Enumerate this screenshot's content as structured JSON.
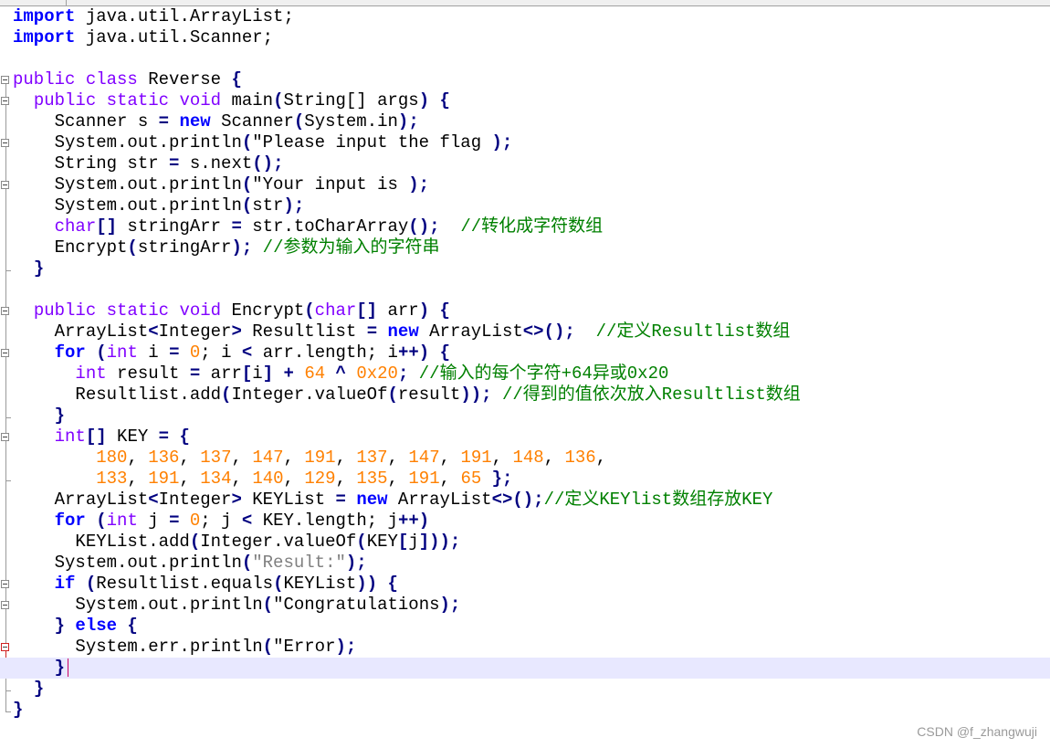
{
  "code": {
    "l1": [
      "import",
      " java.util.ArrayList;"
    ],
    "l2": [
      "import",
      " java.util.Scanner;"
    ],
    "l4": [
      "public class",
      " Reverse ",
      "{"
    ],
    "l5": [
      "  ",
      "public static void",
      " main",
      "(",
      "String",
      "[] args",
      ")",
      " {"
    ],
    "l6": [
      "    Scanner s ",
      "=",
      " ",
      "new",
      " Scanner",
      "(",
      "System.in",
      ");"
    ],
    "l7": [
      "    System.out.println",
      "(",
      "\"Please input the flag ",
      ");"
    ],
    "l8": [
      "    String str ",
      "=",
      " s.next",
      "();"
    ],
    "l9": [
      "    System.out.println",
      "(",
      "\"Your input is ",
      ");"
    ],
    "l10": [
      "    System.out.println",
      "(",
      "str",
      ");"
    ],
    "l11": [
      "    ",
      "char",
      "[]",
      " stringArr ",
      "=",
      " str.toCharArray",
      "();",
      "  ",
      "//转化成字符数组"
    ],
    "l12": [
      "    Encrypt",
      "(",
      "stringArr",
      ");",
      " ",
      "//参数为输入的字符串"
    ],
    "l13": [
      "  ",
      "}"
    ],
    "l15": [
      "  ",
      "public static void",
      " Encrypt",
      "(",
      "char",
      "[]",
      " arr",
      ")",
      " {"
    ],
    "l16": [
      "    ArrayList",
      "<",
      "Integer",
      ">",
      " Resultlist ",
      "=",
      " ",
      "new",
      " ArrayList",
      "<>();",
      "  ",
      "//定义Resultlist数组"
    ],
    "l17": [
      "    ",
      "for",
      " (",
      "int",
      " i ",
      "=",
      " ",
      "0",
      "; i ",
      "<",
      " arr.length; i",
      "++",
      ")",
      " {"
    ],
    "l18": [
      "      ",
      "int",
      " result ",
      "=",
      " arr",
      "[",
      "i",
      "]",
      " ",
      "+",
      " ",
      "64",
      " ",
      "^",
      " ",
      "0x20",
      ";",
      " ",
      "//输入的每个字符+64异或0x20"
    ],
    "l19": [
      "      Resultlist.add",
      "(",
      "Integer.valueOf",
      "(",
      "result",
      "));",
      " ",
      "//得到的值依次放入Resultlist数组"
    ],
    "l20": [
      "    ",
      "}"
    ],
    "l21": [
      "    ",
      "int",
      "[]",
      " KEY ",
      "=",
      " {"
    ],
    "l22": [
      "        ",
      "180",
      ", ",
      "136",
      ", ",
      "137",
      ", ",
      "147",
      ", ",
      "191",
      ", ",
      "137",
      ", ",
      "147",
      ", ",
      "191",
      ", ",
      "148",
      ", ",
      "136",
      ","
    ],
    "l23": [
      "        ",
      "133",
      ", ",
      "191",
      ", ",
      "134",
      ", ",
      "140",
      ", ",
      "129",
      ", ",
      "135",
      ", ",
      "191",
      ", ",
      "65",
      " };"
    ],
    "l24": [
      "    ArrayList",
      "<",
      "Integer",
      ">",
      " KEYList ",
      "=",
      " ",
      "new",
      " ArrayList",
      "<>();",
      "//定义KEYlist数组存放KEY"
    ],
    "l25": [
      "    ",
      "for",
      " (",
      "int",
      " j ",
      "=",
      " ",
      "0",
      "; j ",
      "<",
      " KEY.length; j",
      "++",
      ")"
    ],
    "l26": [
      "      KEYList.add",
      "(",
      "Integer.valueOf",
      "(",
      "KEY",
      "[",
      "j",
      "]));"
    ],
    "l27": [
      "    System.out.println",
      "(",
      "\"Result:\"",
      ");"
    ],
    "l28": [
      "    ",
      "if",
      " (",
      "Resultlist.equals",
      "(",
      "KEYList",
      "))",
      " {"
    ],
    "l29": [
      "      System.out.println",
      "(",
      "\"Congratulations",
      ");"
    ],
    "l30": [
      "    ",
      "}",
      " ",
      "else",
      " {"
    ],
    "l31": [
      "      System.err.println",
      "(",
      "\"Error",
      ");"
    ],
    "l32": [
      "    ",
      "}"
    ],
    "l33": [
      "  ",
      "}"
    ],
    "l34": [
      "}"
    ]
  },
  "watermark": "CSDN @f_zhangwuji"
}
